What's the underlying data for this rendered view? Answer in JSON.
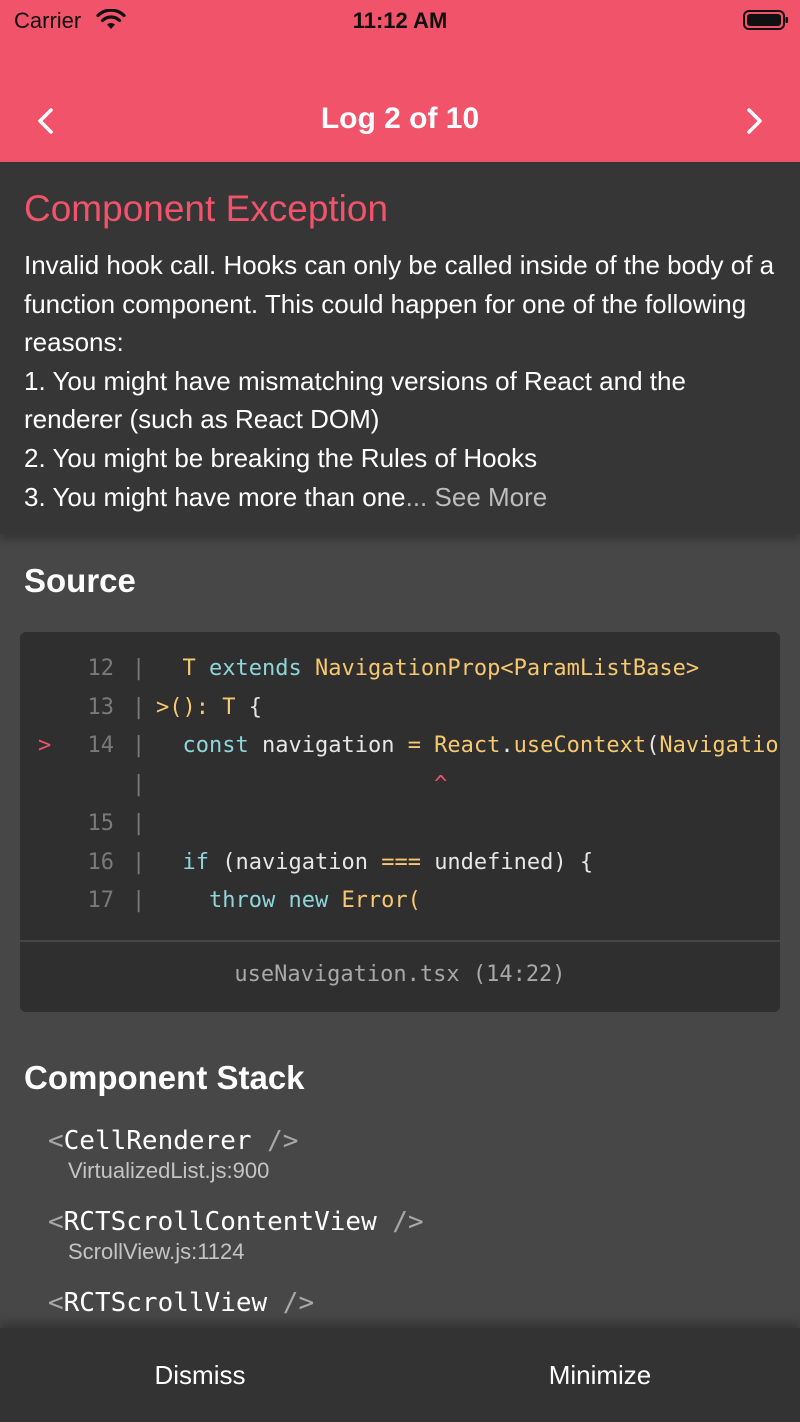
{
  "status_bar": {
    "carrier": "Carrier",
    "time": "11:12 AM"
  },
  "header": {
    "title": "Log 2 of 10",
    "prev_icon": "chevron-left-icon",
    "next_icon": "chevron-right-icon"
  },
  "exception": {
    "title": "Component Exception",
    "message": "Invalid hook call. Hooks can only be called inside of the body of a function component. This could happen for one of the following reasons:\n1. You might have mismatching versions of React and the renderer (such as React DOM)\n2. You might be breaking the Rules of Hooks\n3. You might have more than one",
    "ellipsis": "...",
    "see_more": "See More"
  },
  "source": {
    "title": "Source",
    "lines": [
      {
        "number": "12",
        "arrow": "",
        "tokens": [
          [
            "",
            "  "
          ],
          [
            "y",
            "T "
          ],
          [
            "k",
            "extends "
          ],
          [
            "y",
            "NavigationProp<ParamListBase>"
          ]
        ]
      },
      {
        "number": "13",
        "arrow": "",
        "tokens": [
          [
            "y",
            ">(): T "
          ],
          [
            "w",
            "{"
          ]
        ]
      },
      {
        "number": "14",
        "arrow": ">",
        "tokens": [
          [
            "",
            "  "
          ],
          [
            "k",
            "const "
          ],
          [
            "w",
            "navigation "
          ],
          [
            "y",
            "= React"
          ],
          [
            "w",
            "."
          ],
          [
            "y",
            "useContext"
          ],
          [
            "w",
            "("
          ],
          [
            "y",
            "NavigationContext"
          ]
        ]
      },
      {
        "number": "",
        "arrow": "",
        "tokens": [
          [
            "caret",
            "                     ^"
          ]
        ]
      },
      {
        "number": "15",
        "arrow": "",
        "tokens": []
      },
      {
        "number": "16",
        "arrow": "",
        "tokens": [
          [
            "",
            "  "
          ],
          [
            "k",
            "if "
          ],
          [
            "w",
            "(navigation "
          ],
          [
            "y",
            "=== "
          ],
          [
            "w",
            "undefined) {"
          ]
        ]
      },
      {
        "number": "17",
        "arrow": "",
        "tokens": [
          [
            "",
            "    "
          ],
          [
            "k",
            "throw new "
          ],
          [
            "y",
            "Error("
          ]
        ]
      }
    ],
    "file_location": "useNavigation.tsx (14:22)"
  },
  "component_stack": {
    "title": "Component Stack",
    "items": [
      {
        "name": "CellRenderer",
        "file": "VirtualizedList.js:900"
      },
      {
        "name": "RCTScrollContentView",
        "file": "ScrollView.js:1124"
      },
      {
        "name": "RCTScrollView",
        "file": ""
      }
    ]
  },
  "footer": {
    "dismiss_label": "Dismiss",
    "minimize_label": "Minimize"
  }
}
